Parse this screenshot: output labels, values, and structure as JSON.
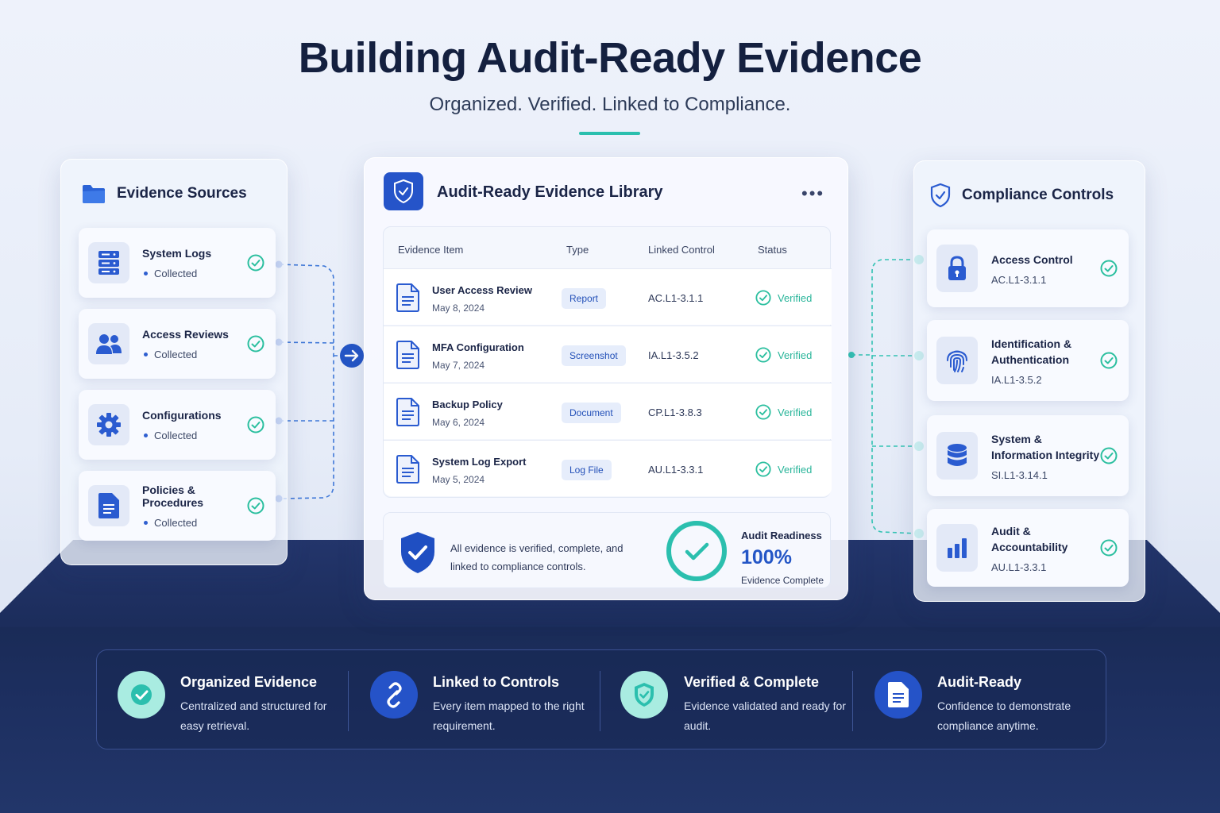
{
  "header": {
    "title": "Building Audit-Ready Evidence",
    "subtitle": "Organized. Verified. Linked to Compliance."
  },
  "sources_panel": {
    "title": "Evidence Sources",
    "items": [
      {
        "label": "System Logs",
        "status": "Collected",
        "icon": "server-icon"
      },
      {
        "label": "Access Reviews",
        "status": "Collected",
        "icon": "users-icon"
      },
      {
        "label": "Configurations",
        "status": "Collected",
        "icon": "gear-icon"
      },
      {
        "label": "Policies & Procedures",
        "status": "Collected",
        "icon": "document-icon"
      }
    ]
  },
  "library": {
    "title": "Audit-Ready Evidence Library",
    "menu": "•••",
    "columns": [
      "Evidence Item",
      "Type",
      "Linked Control",
      "Status"
    ],
    "rows": [
      {
        "name": "User Access Review",
        "date": "May 8, 2024",
        "type": "Report",
        "control": "AC.L1-3.1.1",
        "status": "Verified"
      },
      {
        "name": "MFA Configuration",
        "date": "May 7, 2024",
        "type": "Screenshot",
        "control": "IA.L1-3.5.2",
        "status": "Verified"
      },
      {
        "name": "Backup Policy",
        "date": "May 6, 2024",
        "type": "Document",
        "control": "CP.L1-3.8.3",
        "status": "Verified"
      },
      {
        "name": "System Log Export",
        "date": "May 5, 2024",
        "type": "Log File",
        "control": "AU.L1-3.3.1",
        "status": "Verified"
      }
    ],
    "readiness": {
      "message": "All evidence is verified, complete, and linked to compliance controls.",
      "label": "Audit Readiness",
      "value": "100%",
      "sub": "Evidence Complete",
      "progress": 1.0
    }
  },
  "controls_panel": {
    "title": "Compliance Controls",
    "items": [
      {
        "label": "Access Control",
        "code": "AC.L1-3.1.1",
        "icon": "lock-icon"
      },
      {
        "label": "Identification & Authentication",
        "code": "IA.L1-3.5.2",
        "icon": "fingerprint-icon"
      },
      {
        "label": "System & Information Integrity",
        "code": "SI.L1-3.14.1",
        "icon": "database-icon"
      },
      {
        "label": "Audit & Accountability",
        "code": "AU.L1-3.3.1",
        "icon": "bar-chart-icon"
      }
    ]
  },
  "features": [
    {
      "title": "Organized Evidence",
      "desc": "Centralized and structured for easy retrieval.",
      "icon": "check-circle-icon"
    },
    {
      "title": "Linked to Controls",
      "desc": "Every item mapped to the right requirement.",
      "icon": "link-icon"
    },
    {
      "title": "Verified & Complete",
      "desc": "Evidence validated and ready for audit.",
      "icon": "shield-check-icon"
    },
    {
      "title": "Audit-Ready",
      "desc": "Confidence to demonstrate compliance anytime.",
      "icon": "document-icon"
    }
  ],
  "colors": {
    "brand_blue": "#2554c9",
    "teal": "#2bbfae",
    "verified_green": "#29b59a",
    "navy": "#1a2b57"
  }
}
